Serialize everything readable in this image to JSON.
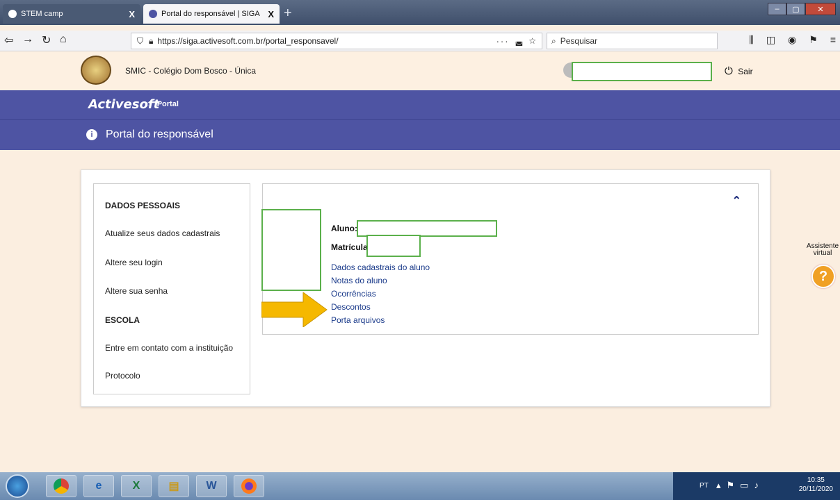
{
  "browser": {
    "tabs": [
      {
        "label": "STEM camp",
        "close": "X"
      },
      {
        "label": "Portal do responsável | SIGA",
        "close": "X"
      }
    ],
    "new_tab": "+",
    "url": "https://siga.activesoft.com.br/portal_responsavel/",
    "page_actions": "···",
    "search_placeholder": "Pesquisar"
  },
  "header": {
    "school_name": "SMIC - Colégio Dom Bosco - Única",
    "logout_label": "Sair"
  },
  "topnav": {
    "brand": "Activesoft",
    "portal_link": "Portal"
  },
  "page": {
    "title": "Portal do responsável"
  },
  "sidebar": {
    "sections": [
      {
        "heading": "DADOS PESSOAIS",
        "items": [
          "Atualize seus dados cadastrais",
          "Altere seu login",
          "Altere sua senha"
        ]
      },
      {
        "heading": "ESCOLA",
        "items": [
          "Entre em contato com a instituição",
          "Protocolo"
        ]
      }
    ]
  },
  "student": {
    "aluno_label": "Aluno:",
    "matricula_label": "Matrícula",
    "links": [
      "Dados cadastrais do aluno",
      "Notas do aluno",
      "Ocorrências",
      "Descontos",
      "Porta arquivos"
    ]
  },
  "assistant": {
    "line1": "Assistente",
    "line2": "virtual",
    "glyph": "?"
  },
  "taskbar": {
    "lang": "PT",
    "time": "10:35",
    "date": "20/11/2020"
  },
  "colors": {
    "brand_blue": "#4e54a3",
    "highlight_green": "#5bb04b",
    "arrow_yellow": "#f5b800",
    "assist_orange": "#f0a024"
  }
}
